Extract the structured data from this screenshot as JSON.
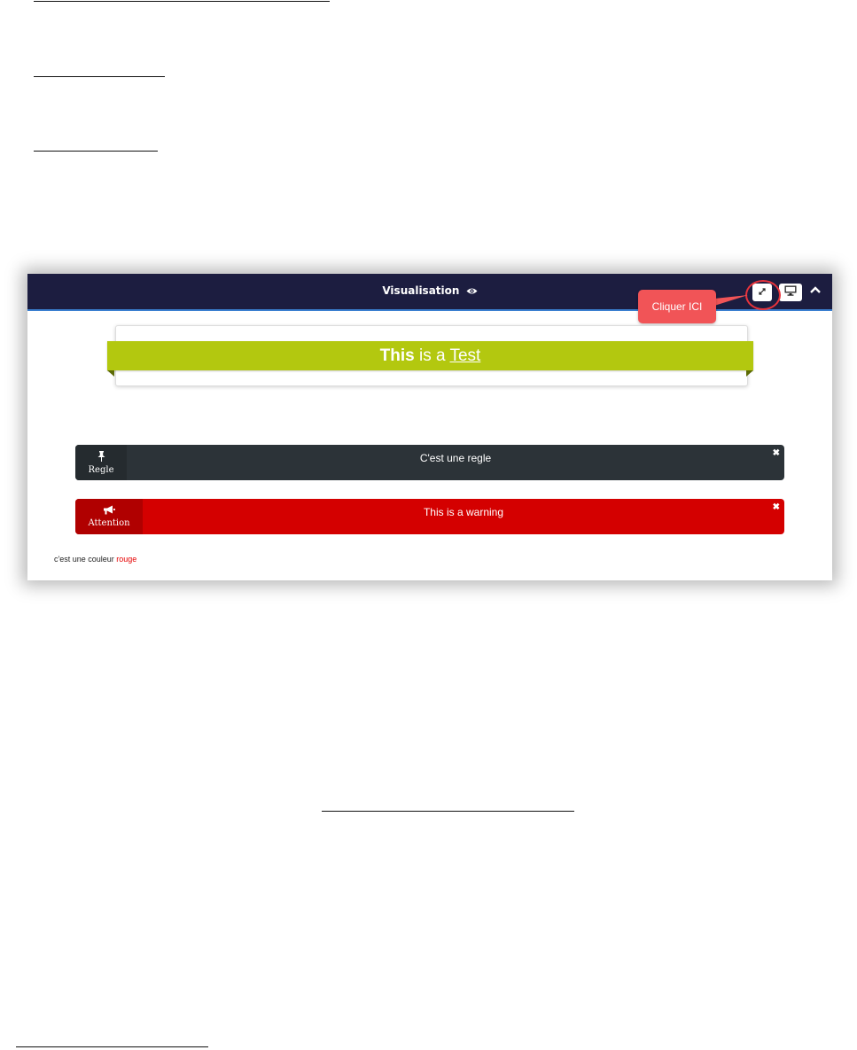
{
  "preview": {
    "title": "Visualisation",
    "icons": {
      "title": "eye-icon",
      "expand": "expand-arrows-icon",
      "screen": "monitor-icon",
      "collapse": "chevron-up-icon"
    },
    "annotation": {
      "callout_text": "Cliquer ICI",
      "color": "#f15457"
    }
  },
  "banner": {
    "bold_word": "This",
    "middle": " is a ",
    "underlined_word": "Test",
    "color": "#b3c80f"
  },
  "alerts": [
    {
      "tag_icon": "pushpin-icon",
      "tag_label": "Regle",
      "message": "C'est une regle",
      "color": "#2c3338",
      "close": "✖"
    },
    {
      "tag_icon": "bullhorn-icon",
      "tag_label": "Attention",
      "message": "This is a warning",
      "color": "#d40000",
      "close": "✖"
    }
  ],
  "footer_line": {
    "prefix": "c'est une couleur ",
    "colored_word": "rouge",
    "colored_word_color": "#e60000"
  }
}
